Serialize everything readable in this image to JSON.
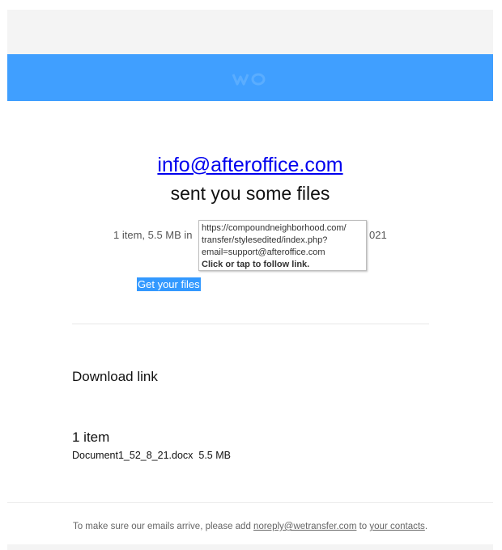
{
  "header": {
    "colors": {
      "banner": "#409fff",
      "top_band": "#f4f4f4"
    },
    "logo_icon": "wetransfer-logo-icon"
  },
  "main": {
    "sender_email": "info@afteroffice.com",
    "headline": "sent you some files",
    "meta_prefix": "1 item, 5.5 MB in",
    "meta_suffix": "021",
    "get_files_label": "Get your files"
  },
  "tooltip": {
    "line1": "https://compoundneighborhood.com/",
    "line2": "transfer/stylesedited/index.php?",
    "line3": "email=support@afteroffice.com",
    "cta": "Click or tap to follow link."
  },
  "details": {
    "download_title": "Download link",
    "items_count": "1 item",
    "file_name": "Document1_52_8_21.docx",
    "file_size": "5.5 MB"
  },
  "footer": {
    "text_before": "To make sure our emails arrive, please add ",
    "noreply_link": "noreply@wetransfer.com",
    "text_middle": " to ",
    "contacts_link": "your contacts",
    "text_after": "."
  }
}
